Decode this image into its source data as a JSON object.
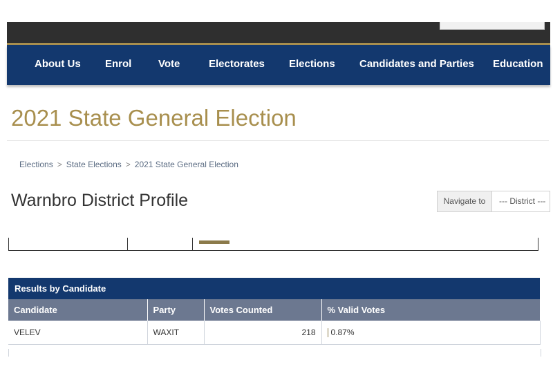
{
  "nav": {
    "items": [
      "About Us",
      "Enrol",
      "Vote",
      "Electorates",
      "Elections",
      "Candidates and Parties",
      "Education"
    ]
  },
  "page": {
    "title": "2021 State General Election",
    "district_title": "Warnbro District Profile"
  },
  "breadcrumb": [
    "Elections",
    "State Elections",
    "2021 State General Election"
  ],
  "navigate": {
    "label": "Navigate to",
    "selected": "--- District ---"
  },
  "results": {
    "heading": "Results by Candidate",
    "columns": [
      "Candidate",
      "Party",
      "Votes Counted",
      "% Valid Votes"
    ],
    "rows": [
      {
        "candidate": "VELEV",
        "party": "WAXIT",
        "votes": "218",
        "pct": "0.87%",
        "pct_value": 0.87
      }
    ]
  },
  "colors": {
    "nav_bg": "#13386e",
    "accent_gold": "#a88f4e",
    "table_header_bg": "#6c7890"
  }
}
